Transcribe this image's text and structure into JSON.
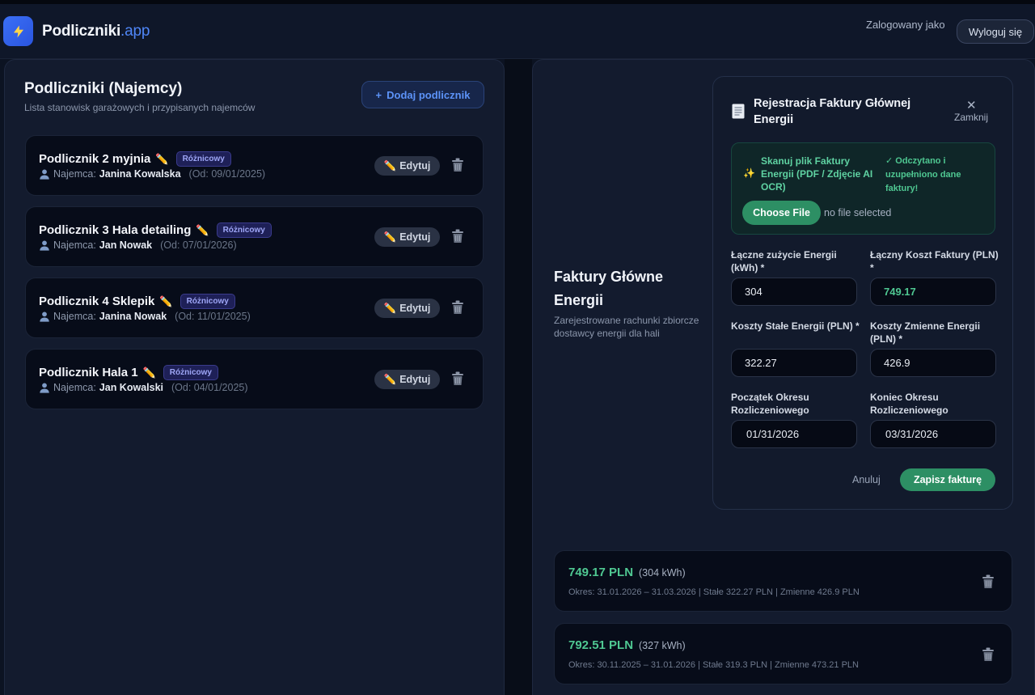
{
  "header": {
    "brand_main": "Podliczniki",
    "brand_suffix": ".app",
    "logged_in_label": "Zalogowany jako",
    "logout_label": "Wyloguj się"
  },
  "left": {
    "title": "Podliczniki (Najemcy)",
    "subtitle": "Lista stanowisk garażowych i przypisanych najemców",
    "add_button": "Dodaj podlicznik",
    "add_icon": "+",
    "tenant_prefix": "Najemca:",
    "edit_label": "Edytuj",
    "cards": [
      {
        "name": "Podlicznik 2 myjnia",
        "badge": "Różnicowy",
        "tenant": "Janina Kowalska",
        "since": "(Od: 09/01/2025)"
      },
      {
        "name": "Podlicznik 3 Hala detailing",
        "badge": "Różnicowy",
        "tenant": "Jan Nowak",
        "since": "(Od: 07/01/2026)"
      },
      {
        "name": "Podlicznik 4 Sklepik",
        "badge": "Różnicowy",
        "tenant": "Janina Nowak",
        "since": "(Od: 11/01/2025)"
      },
      {
        "name": "Podlicznik Hala 1",
        "badge": "Różnicowy",
        "tenant": "Jan Kowalski",
        "since": "(Od: 04/01/2025)"
      }
    ]
  },
  "right": {
    "title": "Faktury Główne Energii",
    "subtitle": "Zarejestrowane rachunki zbiorcze dostawcy energii dla hali",
    "modal": {
      "title": "Rejestracja Faktury Głównej Energii",
      "close_label": "Zamknij",
      "ocr_title": "Skanuj plik Faktury Energii (PDF / Zdjęcie AI OCR)",
      "ocr_success": "✓ Odczytano i uzupełniono dane faktury!",
      "choose_file": "Choose File",
      "no_file": "no file selected",
      "fields": {
        "usage_label": "Łączne zużycie Energii (kWh) *",
        "usage_value": "304",
        "total_label": "Łączny Koszt Faktury (PLN) *",
        "total_value": "749.17",
        "fixed_label": "Koszty Stałe Energii (PLN) *",
        "fixed_value": "322.27",
        "variable_label": "Koszty Zmienne Energii (PLN) *",
        "variable_value": "426.9",
        "start_label": "Początek Okresu Rozliczeniowego",
        "start_value": "01/31/2026",
        "end_label": "Koniec Okresu Rozliczeniowego",
        "end_value": "03/31/2026"
      },
      "cancel_label": "Anuluj",
      "save_label": "Zapisz fakturę"
    },
    "invoices": [
      {
        "amount": "749.17 PLN",
        "kwh": "(304 kWh)",
        "details": "Okres: 31.01.2026 – 31.03.2026 | Stałe 322.27 PLN | Zmienne 426.9 PLN"
      },
      {
        "amount": "792.51 PLN",
        "kwh": "(327 kWh)",
        "details": "Okres: 30.11.2025 – 31.01.2026 | Stałe 319.3 PLN | Zmienne 473.21 PLN"
      }
    ]
  },
  "colors": {
    "accent_blue": "#4f86f7",
    "accent_green": "#2d8f64",
    "badge_purple": "#9ea6f6",
    "background": "#0c1322"
  },
  "icons": [
    "lightning-icon",
    "plus-icon",
    "pencil-icon",
    "person-icon",
    "trash-icon",
    "document-icon",
    "close-icon",
    "sparkle-icon",
    "checkmark-icon"
  ]
}
